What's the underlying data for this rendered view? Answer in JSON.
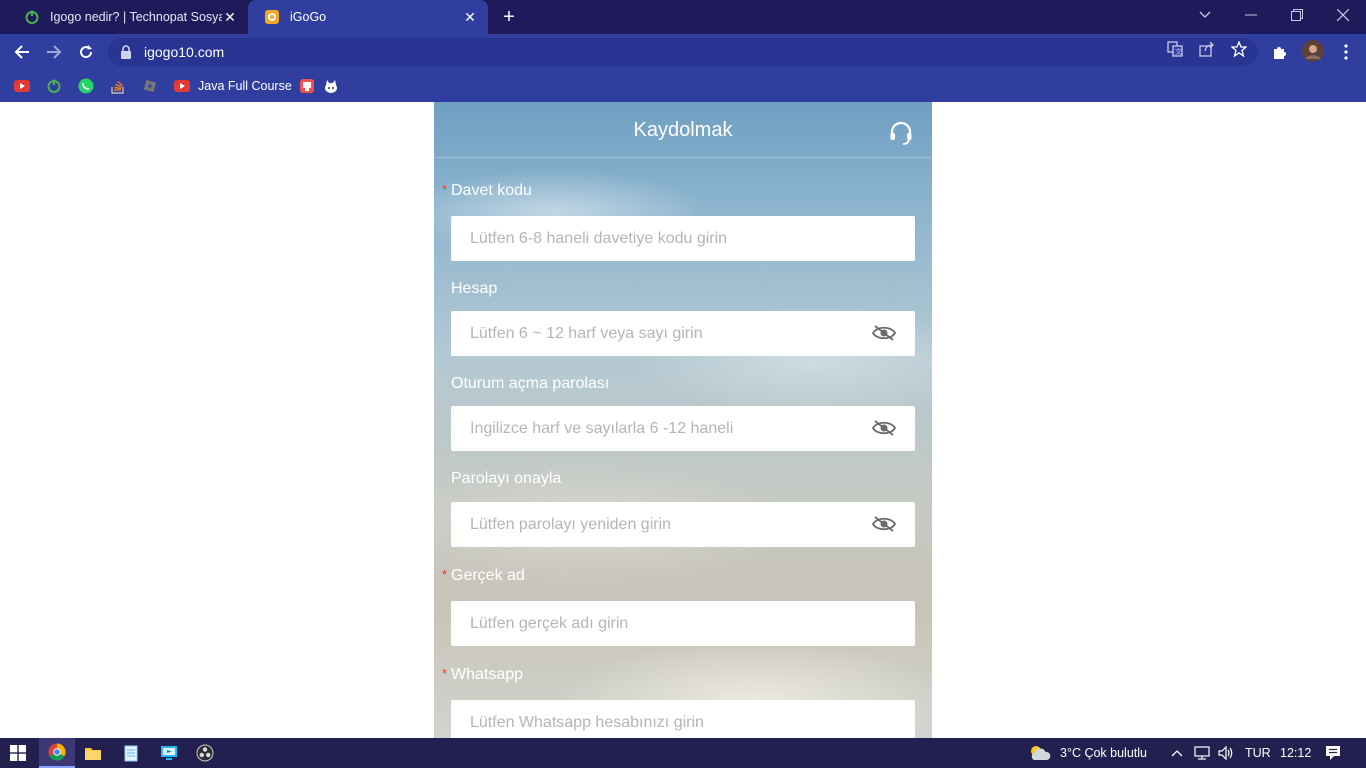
{
  "browser": {
    "tabs": [
      {
        "title": "Igogo nedir? | Technopat Sosyal",
        "active": false
      },
      {
        "title": "iGoGo",
        "active": true
      }
    ],
    "new_tab_label": "+",
    "url": "igogo10.com",
    "bookmarks": [
      {
        "label": "",
        "icon": "youtube-icon"
      },
      {
        "label": "",
        "icon": "power-icon"
      },
      {
        "label": "",
        "icon": "whatsapp-icon"
      },
      {
        "label": "",
        "icon": "stackoverflow-icon"
      },
      {
        "label": "",
        "icon": "roblox-icon"
      },
      {
        "label": "Java Full Course",
        "icon": "youtube-icon"
      },
      {
        "label": "",
        "icon": "app-icon"
      },
      {
        "label": "",
        "icon": "cat-icon"
      }
    ]
  },
  "page": {
    "title": "Kaydolmak",
    "support_icon": "headset-icon",
    "fields": [
      {
        "label": "Davet kodu",
        "required": true,
        "placeholder": "Lütfen 6-8 haneli davetiye kodu girin",
        "eye": false
      },
      {
        "label": "Hesap",
        "required": false,
        "placeholder": "Lütfen 6 ~ 12 harf veya sayı girin",
        "eye": true
      },
      {
        "label": "Oturum açma parolası",
        "required": false,
        "placeholder": "İngilizce harf ve sayılarla 6 -12 haneli",
        "eye": true
      },
      {
        "label": "Parolayı onayla",
        "required": false,
        "placeholder": "Lütfen parolayı yeniden girin",
        "eye": true
      },
      {
        "label": "Gerçek ad",
        "required": true,
        "placeholder": "Lütfen gerçek adı girin",
        "eye": false
      },
      {
        "label": "Whatsapp",
        "required": true,
        "placeholder": "Lütfen Whatsapp hesabınızı girin",
        "eye": false
      }
    ],
    "required_mark": "*"
  },
  "taskbar": {
    "weather": "3°C  Çok bulutlu",
    "language": "TUR",
    "time": "12:12"
  },
  "colors": {
    "tabstrip": "#1f1b5a",
    "toolbar": "#303f9f",
    "required": "#e53935",
    "taskbar": "#23204f"
  }
}
